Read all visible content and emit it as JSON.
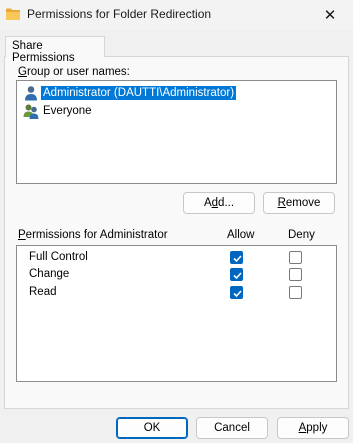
{
  "window": {
    "title": "Permissions for Folder Redirection",
    "close_glyph": "✕",
    "icon": "folder-icon"
  },
  "tabs": [
    {
      "label": "Share Permissions",
      "active": true
    }
  ],
  "group_section": {
    "label_first": "G",
    "label_rest": "roup or user names:",
    "users": [
      {
        "name": "Administrator (DAUTTI\\Administrator)",
        "icon": "user-icon",
        "selected": true
      },
      {
        "name": "Everyone",
        "icon": "group-icon",
        "selected": false
      }
    ],
    "add_button": {
      "first": "A",
      "u": "d",
      "rest": "d..."
    },
    "remove_button": {
      "u": "R",
      "rest": "emove"
    }
  },
  "permissions_section": {
    "label_first": "P",
    "label_rest": "ermissions for Administrator",
    "allow_header": "Allow",
    "deny_header": "Deny",
    "rows": [
      {
        "name": "Full Control",
        "allow": true,
        "deny": false
      },
      {
        "name": "Change",
        "allow": true,
        "deny": false
      },
      {
        "name": "Read",
        "allow": true,
        "deny": false
      }
    ]
  },
  "footer": {
    "ok_label": "OK",
    "cancel_label": "Cancel",
    "apply_first": "A",
    "apply_rest": "pply"
  },
  "colors": {
    "selection": "#0078d7",
    "checkbox_checked": "#0067c0",
    "primary_border": "#0067c0"
  }
}
